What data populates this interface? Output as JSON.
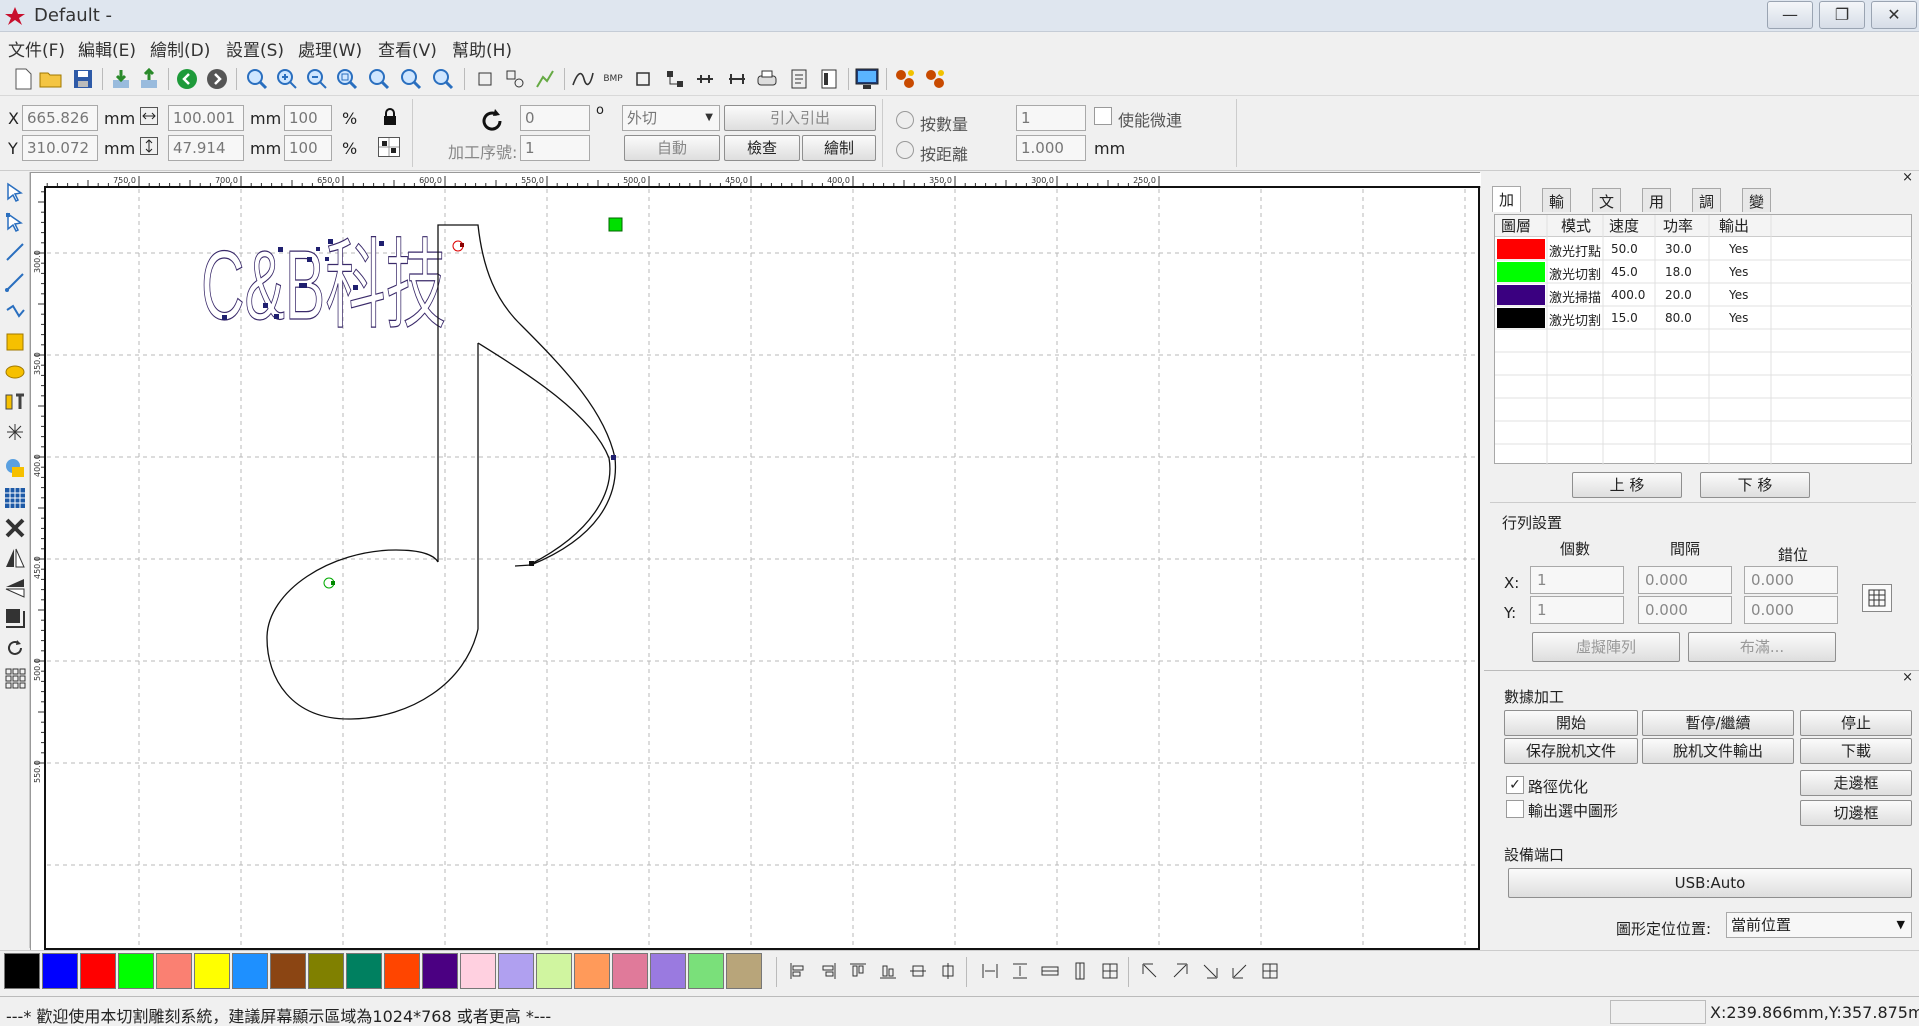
{
  "window": {
    "title": "Default -",
    "minimize": "—",
    "restore": "❐",
    "close": "✕"
  },
  "menu": [
    "文件(F)",
    "編輯(E)",
    "繪制(D)",
    "設置(S)",
    "處理(W)",
    "查看(V)",
    "幫助(H)"
  ],
  "toolbar": {
    "icons": [
      "new-file-icon",
      "open-folder-icon",
      "save-icon",
      "import-icon",
      "export-icon",
      "undo-icon",
      "redo-icon",
      "zoom-in-icon",
      "zoom-plus-icon",
      "zoom-out-icon",
      "zoom-fit-icon",
      "zoom-page-icon",
      "zoom-select-icon",
      "zoom-all-icon",
      "select-rect-icon",
      "node-edit-icon",
      "path-icon",
      "curve-icon",
      "bmp-icon",
      "rect-icon",
      "group-icon",
      "ungroup-icon",
      "align-icon",
      "print-icon",
      "document-icon",
      "layout-icon",
      "monitor-icon",
      "bug-icon",
      "cloud-icon"
    ],
    "bmp_label": "BMP"
  },
  "props": {
    "x_label": "X",
    "x_value": "665.826",
    "y_label": "Y",
    "y_value": "310.072",
    "unit_mm": "mm",
    "width_value": "100.001",
    "height_value": "47.914",
    "scale_w": "100",
    "scale_h": "100",
    "percent": "%",
    "rotation_value": "0",
    "degree": "o",
    "process_order_label": "加工序號:",
    "process_order_value": "1",
    "cut_mode": "外切",
    "lead_in_out": "引入引出",
    "auto_button": "自動",
    "check_button": "檢查",
    "draw_button": "繪制",
    "by_count_label": "按數量",
    "by_count_value": "1",
    "by_distance_label": "按距離",
    "by_distance_value": "1.000",
    "micro_connect_label": "使能微連",
    "distance_unit": "mm"
  },
  "canvas": {
    "ruler_top": [
      "750.0",
      "700.0",
      "650.0",
      "600.0",
      "550.0",
      "500.0",
      "450.0",
      "400.0",
      "350.0",
      "300.0",
      "250.0"
    ],
    "ruler_left": [
      "300.0",
      "350.0",
      "400.0",
      "450.0",
      "500.0",
      "550.0"
    ],
    "text_art": "C&B科技"
  },
  "panel": {
    "tabs": [
      "加工",
      "輸出",
      "文檔",
      "用戶",
      "調試",
      "變換"
    ],
    "table_headers": [
      "圖層",
      "模式",
      "速度",
      "功率",
      "輸出"
    ],
    "layers": [
      {
        "color": "#ff0000",
        "mode": "激光打點",
        "speed": "50.0",
        "power": "30.0",
        "output": "Yes"
      },
      {
        "color": "#00ff00",
        "mode": "激光切割",
        "speed": "45.0",
        "power": "18.0",
        "output": "Yes"
      },
      {
        "color": "#3a0080",
        "mode": "激光掃描",
        "speed": "400.0",
        "power": "20.0",
        "output": "Yes"
      },
      {
        "color": "#000000",
        "mode": "激光切割",
        "speed": "15.0",
        "power": "80.0",
        "output": "Yes"
      }
    ],
    "move_up": "上 移",
    "move_down": "下 移",
    "array_title": "行列設置",
    "array_headers": [
      "個數",
      "間隔",
      "錯位"
    ],
    "array_x_label": "X:",
    "array_y_label": "Y:",
    "array_x": [
      "1",
      "0.000",
      "0.000"
    ],
    "array_y": [
      "1",
      "0.000",
      "0.000"
    ],
    "virtual_array": "虛擬陣列",
    "layout_btn": "布滿...",
    "data_process_title": "數據加工",
    "start": "開始",
    "pause_resume": "暫停/繼續",
    "stop": "停止",
    "save_offline": "保存脫机文件",
    "export_offline": "脫机文件輸出",
    "download": "下載",
    "path_optimize": "路徑优化",
    "output_selected": "輸出選中圖形",
    "walk_border": "走邊框",
    "cut_border": "切邊框",
    "device_port_title": "設備端口",
    "usb": "USB:Auto",
    "position_label": "圖形定位位置:",
    "position_value": "當前位置"
  },
  "palette": [
    "#000000",
    "#0000ff",
    "#ff0000",
    "#00ff00",
    "#fa8072",
    "#ffff00",
    "#1e90ff",
    "#8b4513",
    "#808000",
    "#008060",
    "#ff4500",
    "#4b0082",
    "#ffd0e0",
    "#b0a0f0",
    "#d0f5a0",
    "#ff9a5a",
    "#e07a9a",
    "#9a7ae0",
    "#7ae07a",
    "#b8a57a"
  ],
  "status": {
    "message": "---* 歡迎使用本切割雕刻系統，建議屏幕顯示區域為1024*768 或者更高 *---",
    "coords": "X:239.866mm,Y:357.875m"
  }
}
